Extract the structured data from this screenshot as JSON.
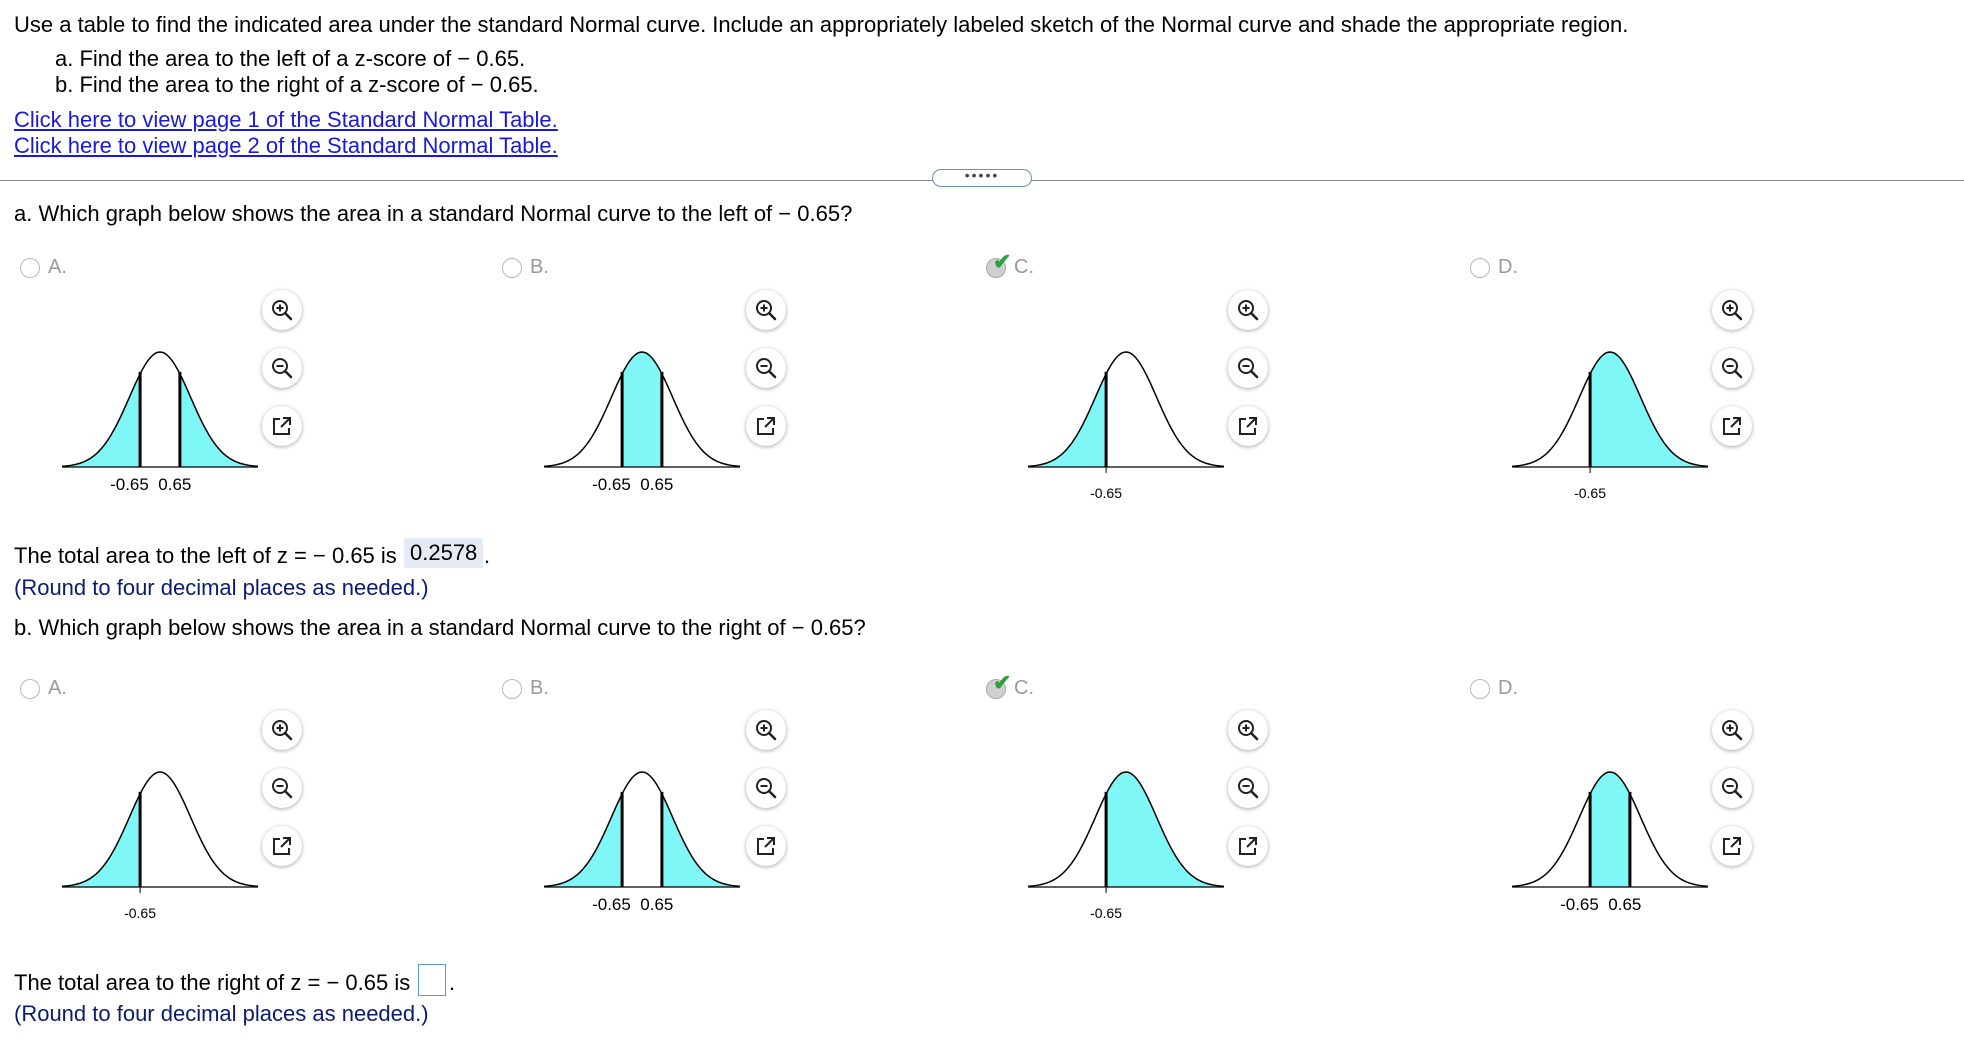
{
  "header": {
    "instruction": "Use a table to find the indicated area under the standard Normal curve. Include an appropriately labeled sketch of the Normal curve and shade the appropriate region.",
    "item_a": "a. Find the area to the left of a z-score of  − 0.65.",
    "item_b": "b. Find the area to the right of a z-score of  − 0.65.",
    "link_1": "Click here to view page 1 of the Standard Normal Table.",
    "link_2": "Click here to view page 2 of the Standard Normal Table."
  },
  "expander": "•••••",
  "part_a": {
    "question": "a. Which graph below shows the area in a standard Normal curve to the left of  − 0.65?",
    "options": [
      {
        "label": "A.",
        "tick_labels": "-0.65  0.65"
      },
      {
        "label": "B.",
        "tick_labels": "-0.65  0.65"
      },
      {
        "label": "C.",
        "tick_labels": "-0.65",
        "selected": true
      },
      {
        "label": "D.",
        "tick_labels": "-0.65"
      }
    ],
    "answer_prefix": "The total area to the left of z =  − 0.65 is",
    "answer_value": "0.2578",
    "answer_suffix": ".",
    "hint": "(Round to four decimal places as needed.)"
  },
  "part_b": {
    "question": "b. Which graph below shows the area in a standard Normal curve to the right of  − 0.65?",
    "options": [
      {
        "label": "A.",
        "tick_labels": "-0.65"
      },
      {
        "label": "B.",
        "tick_labels": "-0.65  0.65"
      },
      {
        "label": "C.",
        "tick_labels": "-0.65",
        "selected": true
      },
      {
        "label": "D.",
        "tick_labels": "-0.65  0.65"
      }
    ],
    "answer_prefix": "The total area to the right of z =  − 0.65 is",
    "answer_value": "",
    "answer_suffix": ".",
    "hint": "(Round to four decimal places as needed.)"
  },
  "colors": {
    "shade": "#7ff7f7",
    "check": "#2f9e3c",
    "link": "#1a1ad6",
    "hint": "#0b1c6f"
  },
  "icons": [
    "zoom-in-icon",
    "zoom-out-icon",
    "popout-icon",
    "check-icon"
  ]
}
